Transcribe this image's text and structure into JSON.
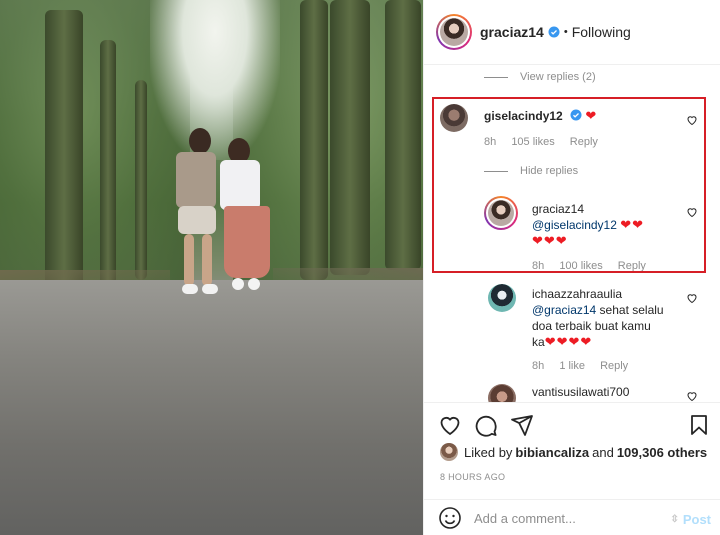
{
  "header": {
    "username": "graciaz14",
    "separator": "•",
    "following_label": "Following",
    "verified_icon": "verified-badge-icon"
  },
  "comments": {
    "view_replies_top": "View replies (2)",
    "gisela": {
      "username": "giselacindy12",
      "text": "❤",
      "time": "8h",
      "likes": "105 likes",
      "reply": "Reply",
      "hide_replies": "Hide replies"
    },
    "gracia_reply": {
      "username": "graciaz14",
      "mention": "@giselacindy12",
      "hearts_line1": "❤❤",
      "hearts_line2": "❤❤❤",
      "time": "8h",
      "likes": "100 likes",
      "reply": "Reply"
    },
    "icha": {
      "username": "ichaazzahraaulia",
      "mention": "@graciaz14",
      "text1": " sehat selalu",
      "text2": "doa terbaik buat kamu",
      "text3": "ka",
      "hearts": "❤❤❤❤",
      "time": "8h",
      "likes": "1 like",
      "reply": "Reply"
    },
    "vanti": {
      "username": "vantisusilawati700"
    }
  },
  "actions": {
    "liked_by_prefix": "Liked by ",
    "liked_by_user": "bibiancaliza",
    "liked_by_mid": " and ",
    "liked_by_count": "109,306 others",
    "timestamp": "8 HOURS AGO",
    "comment_placeholder": "Add a comment...",
    "post_label": "Post"
  },
  "colors": {
    "highlight_border": "#d61f26",
    "heart": "#ed1c24",
    "mention": "#00376b",
    "verified": "#3897f0",
    "post_disabled": "#b2dffc"
  }
}
